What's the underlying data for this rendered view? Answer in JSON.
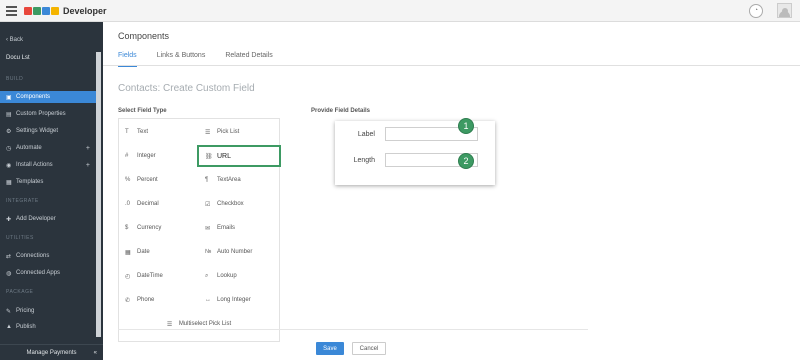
{
  "topbar": {
    "brand_colors": [
      "#e8473c",
      "#3b88d7",
      "#3d9a63",
      "#f4b400"
    ],
    "title": "Developer",
    "menu_icon": "hamburger-icon",
    "help_icon": "help-circle-icon",
    "avatar_icon": "user-avatar-icon"
  },
  "sidebar": {
    "back_label": "Back",
    "app_name": "Docu Lst",
    "section_build": "BUILD",
    "section_integrate": "INTEGRATE",
    "section_utilities": "UTILITIES",
    "section_package": "PACKAGE",
    "items": [
      {
        "label": "Components",
        "icon": "components-icon",
        "active": true
      },
      {
        "label": "Custom Properties",
        "icon": "properties-icon"
      },
      {
        "label": "Settings Widget",
        "icon": "settings-widget-icon"
      },
      {
        "label": "Automate",
        "icon": "automate-icon",
        "expand": "+"
      },
      {
        "label": "Install Actions",
        "icon": "install-actions-icon",
        "expand": "+"
      },
      {
        "label": "Templates",
        "icon": "templates-icon"
      },
      {
        "label": "Add Developer",
        "icon": "add-developer-icon"
      },
      {
        "label": "Connections",
        "icon": "connections-icon"
      },
      {
        "label": "Connected Apps",
        "icon": "connected-apps-icon"
      },
      {
        "label": "Pricing",
        "icon": "pricing-icon"
      },
      {
        "label": "Publish",
        "icon": "publish-icon"
      }
    ],
    "footer_label": "Manage Payments",
    "accent": "#3b88d7",
    "background": "#2b343d"
  },
  "main": {
    "page_title": "Components",
    "tabs": [
      {
        "label": "Fields",
        "active": true
      },
      {
        "label": "Links & Buttons"
      },
      {
        "label": "Related Details"
      }
    ],
    "section_title": "Contacts: Create Custom Field",
    "select_label": "Select Field Type",
    "field_types": [
      {
        "label": "Text",
        "icon": "text-field-icon"
      },
      {
        "label": "Pick List",
        "icon": "picklist-icon"
      },
      {
        "label": "Integer",
        "icon": "integer-icon"
      },
      {
        "label": "URL",
        "icon": "link-icon",
        "selected": true
      },
      {
        "label": "Percent",
        "icon": "percent-icon"
      },
      {
        "label": "TextArea",
        "icon": "textarea-icon"
      },
      {
        "label": "Decimal",
        "icon": "decimal-icon"
      },
      {
        "label": "Checkbox",
        "icon": "checkbox-icon"
      },
      {
        "label": "Currency",
        "icon": "currency-icon"
      },
      {
        "label": "Emails",
        "icon": "email-icon"
      },
      {
        "label": "Date",
        "icon": "calendar-icon"
      },
      {
        "label": "Auto Number",
        "icon": "auto-number-icon"
      },
      {
        "label": "DateTime",
        "icon": "datetime-icon"
      },
      {
        "label": "Lookup",
        "icon": "lookup-icon"
      },
      {
        "label": "Phone",
        "icon": "phone-icon"
      },
      {
        "label": "Long Integer",
        "icon": "long-integer-icon"
      },
      {
        "label": "Multiselect Pick List",
        "icon": "multiselect-icon"
      }
    ],
    "provide_label": "Provide Field Details",
    "details": {
      "label_field": {
        "label": "Label",
        "value": "",
        "badge": "1"
      },
      "length_field": {
        "label": "Length",
        "value": "",
        "badge": "2"
      }
    },
    "save_label": "Save",
    "cancel_label": "Cancel",
    "highlight_color": "#3d9a63"
  }
}
